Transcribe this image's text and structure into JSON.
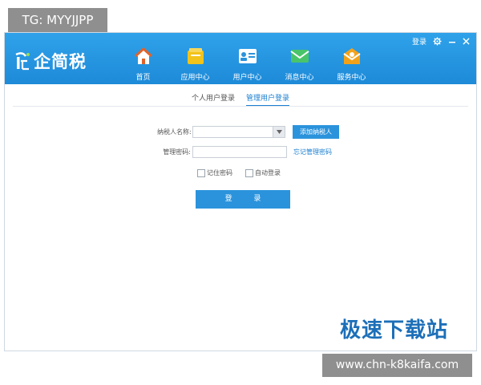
{
  "watermarks": {
    "top_left_tag": "TG: MYYJJPP",
    "bottom_right_url": "www.chn-k8kaifa.com",
    "brand": "极速下载站"
  },
  "app": {
    "logo_text": "企简税",
    "nav": [
      {
        "label": "首页",
        "icon": "home-icon"
      },
      {
        "label": "应用中心",
        "icon": "apps-icon"
      },
      {
        "label": "用户中心",
        "icon": "user-card-icon"
      },
      {
        "label": "消息中心",
        "icon": "message-icon"
      },
      {
        "label": "服务中心",
        "icon": "service-icon"
      }
    ],
    "window_controls": {
      "login_label": "登录",
      "settings_icon": "gear-icon",
      "minimize_icon": "minimize-icon",
      "close_icon": "close-icon"
    },
    "tabs": [
      {
        "label": "个人用户登录",
        "active": false
      },
      {
        "label": "管理用户登录",
        "active": true
      }
    ],
    "form": {
      "taxpayer_label": "纳税人名称:",
      "taxpayer_value": "",
      "add_taxpayer_button": "添加纳税人",
      "password_label": "管理密码:",
      "password_value": "",
      "forgot_password_link": "忘记管理密码",
      "remember_password_label": "记住密码",
      "auto_login_label": "自动登录",
      "login_button": "登 录"
    },
    "colors": {
      "header": "#2196e4",
      "accent": "#2b93dc",
      "link": "#1a7fd0"
    }
  }
}
